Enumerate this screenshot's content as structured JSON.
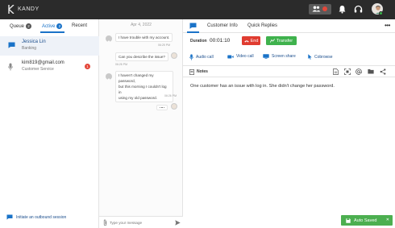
{
  "app": {
    "title": "KANDY"
  },
  "header": {
    "queue_icon": "users-icon",
    "notifications_icon": "bell-icon",
    "headset_icon": "headset-icon"
  },
  "left_tabs": [
    {
      "label": "Queue",
      "count": "2"
    },
    {
      "label": "Active",
      "count": "2"
    },
    {
      "label": "Recent",
      "count": ""
    }
  ],
  "conversations": [
    {
      "name": "Jessica Lin",
      "subtitle": "Banking",
      "icon": "chat-icon",
      "unread": ""
    },
    {
      "name": "kim819@gmail.com",
      "subtitle": "Customer Service",
      "icon": "microphone-icon",
      "unread": "1"
    }
  ],
  "outbound": {
    "label": "Initiate an outbound session"
  },
  "chat": {
    "date": "Apr 4, 2022",
    "messages": [
      {
        "text": "I have trouble with my account.",
        "time": "06:25 PM",
        "from": "customer"
      },
      {
        "text": "Can you describe the issue?",
        "time": "06:26 PM",
        "from": "agent"
      },
      {
        "text_lines": [
          "I haven't changed my password,",
          "but this morning I couldn't log in",
          "using my old password."
        ],
        "time": "06:26 PM",
        "from": "customer"
      }
    ],
    "composer_placeholder": "Type your message"
  },
  "right_tabs": [
    {
      "label": "Customer Info"
    },
    {
      "label": "Quick Replies"
    }
  ],
  "call": {
    "duration_label": "Duration",
    "duration_value": "00:01:10",
    "end_label": "End",
    "transfer_label": "Transfer"
  },
  "actions": [
    {
      "label": "Audio call",
      "icon": "microphone-icon"
    },
    {
      "label": "Video call",
      "icon": "video-icon"
    },
    {
      "label": "Screen share",
      "icon": "screen-share-icon"
    },
    {
      "label": "Cobrowse",
      "icon": "cursor-icon"
    }
  ],
  "notes": {
    "label": "Notes",
    "text": "One customer has an issue with log in. She didn't change her password.",
    "autosaved_label": "Auto Saved"
  },
  "colors": {
    "accent": "#1a73c8",
    "end": "#e03c31",
    "transfer": "#3fb24d",
    "topbar": "#2b2b2b"
  }
}
